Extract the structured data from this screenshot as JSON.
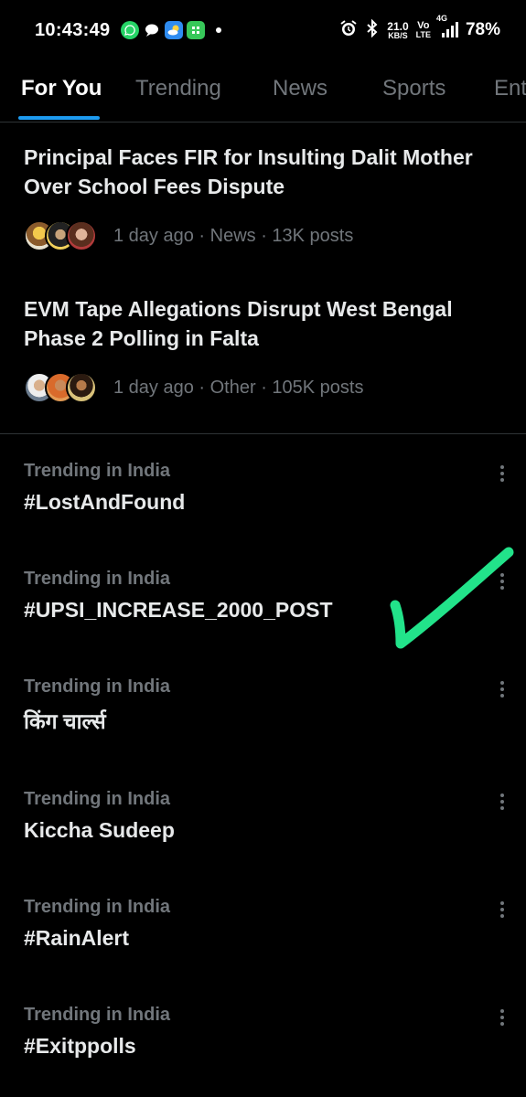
{
  "status_bar": {
    "time": "10:43:49",
    "speed_value": "21.0",
    "speed_unit": "KB/S",
    "network_top": "Vo",
    "network_bottom": "LTE",
    "signal_label": "4G",
    "battery": "78%",
    "icons": [
      "whatsapp-icon",
      "chat-icon",
      "weather-icon",
      "app-icon",
      "alarm-icon",
      "bluetooth-icon",
      "signal-icon"
    ]
  },
  "tabs": [
    {
      "label": "For You",
      "active": true
    },
    {
      "label": "Trending",
      "active": false
    },
    {
      "label": "News",
      "active": false
    },
    {
      "label": "Sports",
      "active": false
    },
    {
      "label": "Ent",
      "active": false
    }
  ],
  "news": [
    {
      "title": "Principal Faces FIR for Insulting Dalit Mother Over School Fees Dispute",
      "meta": "1 day ago · News · 13K posts"
    },
    {
      "title": "EVM Tape Allegations Disrupt West Bengal Phase 2 Polling in Falta",
      "meta": "1 day ago · Other · 105K posts"
    }
  ],
  "trends": [
    {
      "context": "Trending in India",
      "name": "#LostAndFound"
    },
    {
      "context": "Trending in India",
      "name": "#UPSI_INCREASE_2000_POST"
    },
    {
      "context": "Trending in India",
      "name": "किंग चार्ल्स"
    },
    {
      "context": "Trending in India",
      "name": "Kiccha Sudeep"
    },
    {
      "context": "Trending in India",
      "name": "#RainAlert"
    },
    {
      "context": "Trending in India",
      "name": "#Exitppolls"
    }
  ],
  "colors": {
    "background": "#000000",
    "accent": "#1d9bf0",
    "muted": "#71767b",
    "annotation": "#22e38a"
  }
}
